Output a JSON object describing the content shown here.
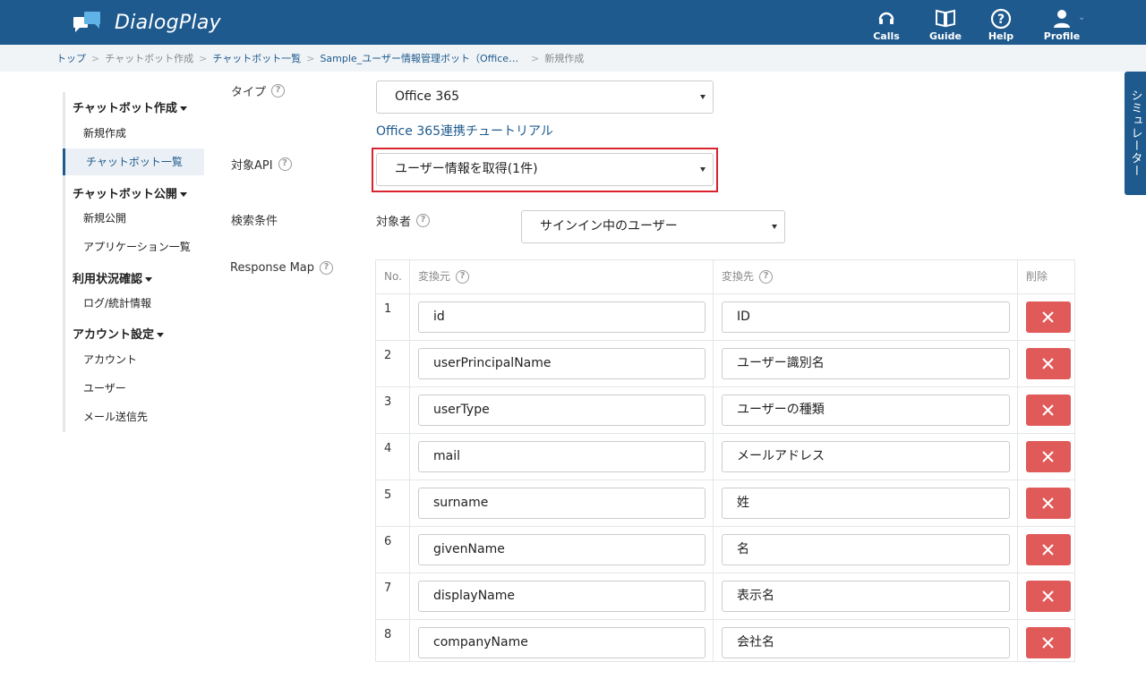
{
  "header": {
    "app_name": "DialogPlay",
    "nav": [
      {
        "label": "Calls",
        "icon": "headset-icon"
      },
      {
        "label": "Guide",
        "icon": "book-icon"
      },
      {
        "label": "Help",
        "icon": "question-icon"
      },
      {
        "label": "Profile",
        "icon": "user-icon"
      }
    ],
    "brand_color": "#1e5a8e"
  },
  "breadcrumb": [
    "トップ",
    "チャットボット作成",
    "チャットボット一覧",
    "Sample_ユーザー情報管理ボット（Office…",
    "新規作成"
  ],
  "sidebar": {
    "groups": [
      {
        "title": "チャットボット作成",
        "items": [
          "新規作成",
          "チャットボット一覧"
        ]
      },
      {
        "title": "チャットボット公開",
        "items": [
          "新規公開",
          "アプリケーション一覧"
        ]
      },
      {
        "title": "利用状況確認",
        "items": [
          "ログ/統計情報"
        ]
      },
      {
        "title": "アカウント設定",
        "items": [
          "アカウント",
          "ユーザー",
          "メール送信先"
        ]
      }
    ],
    "active_item": "チャットボット一覧"
  },
  "form": {
    "type_label": "タイプ",
    "type_value": "Office 365",
    "tutorial_link": "Office 365連携チュートリアル",
    "api_label": "対象API",
    "api_value": "ユーザー情報を取得(1件)",
    "search_label": "検索条件",
    "target_label": "対象者",
    "target_value": "サインイン中のユーザー",
    "response_map_label": "Response Map"
  },
  "table": {
    "headers": {
      "no": "No.",
      "source": "変換元",
      "dest": "変換先",
      "delete": "削除"
    },
    "rows": [
      {
        "no": "1",
        "source": "id",
        "dest": "ID"
      },
      {
        "no": "2",
        "source": "userPrincipalName",
        "dest": "ユーザー識別名"
      },
      {
        "no": "3",
        "source": "userType",
        "dest": "ユーザーの種類"
      },
      {
        "no": "4",
        "source": "mail",
        "dest": "メールアドレス"
      },
      {
        "no": "5",
        "source": "surname",
        "dest": "姓"
      },
      {
        "no": "6",
        "source": "givenName",
        "dest": "名"
      },
      {
        "no": "7",
        "source": "displayName",
        "dest": "表示名"
      },
      {
        "no": "8",
        "source": "companyName",
        "dest": "会社名"
      }
    ],
    "delete_color": "#e05a5a"
  },
  "simulator_tab": "シミュレーター",
  "highlight_color": "#d9232d"
}
